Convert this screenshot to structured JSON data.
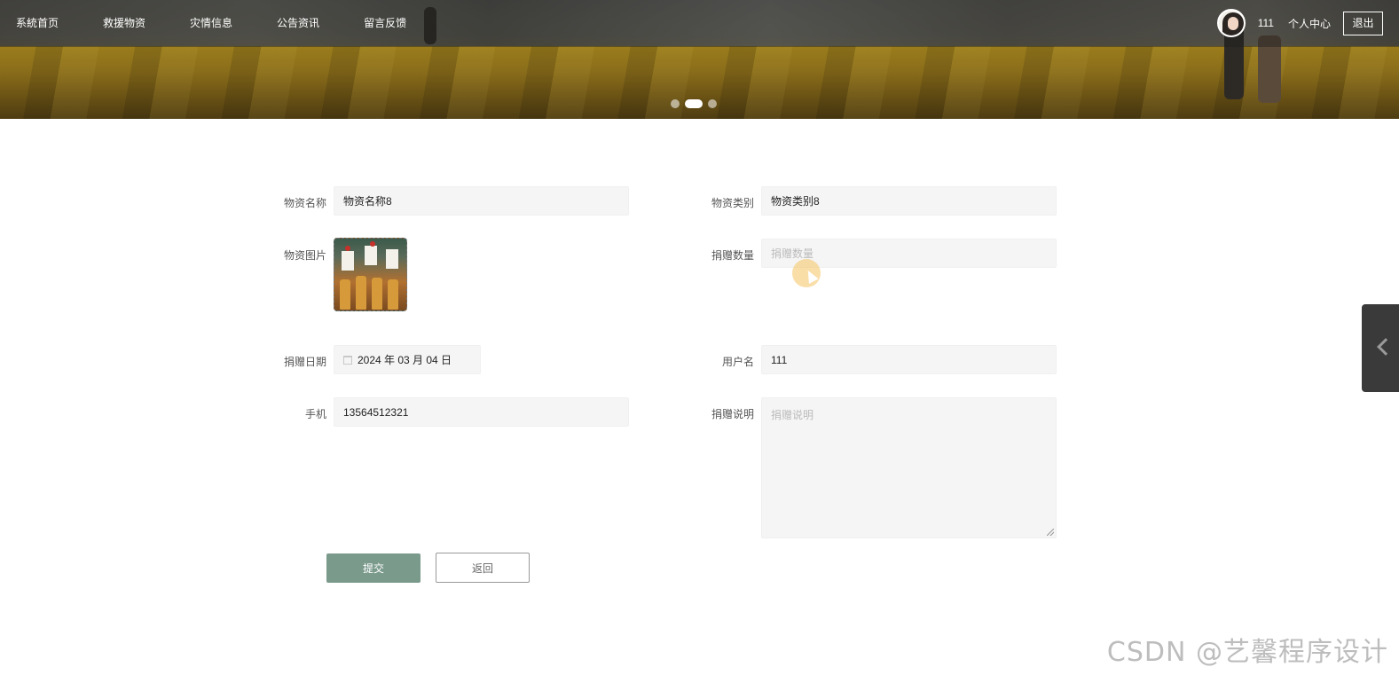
{
  "nav": {
    "items": [
      "系統首页",
      "救援物资",
      "灾情信息",
      "公告资讯",
      "留言反馈"
    ]
  },
  "user": {
    "name": "111",
    "center_label": "个人中心",
    "logout_label": "退出"
  },
  "carousel": {
    "active_index": 1,
    "count": 3
  },
  "form": {
    "material_name": {
      "label": "物资名称",
      "value": "物资名称8"
    },
    "material_category": {
      "label": "物资类别",
      "value": "物资类别8"
    },
    "material_image": {
      "label": "物资图片"
    },
    "donation_quantity": {
      "label": "捐赠数量",
      "placeholder": "捐赠数量"
    },
    "donation_date": {
      "label": "捐赠日期",
      "value": "2024 年 03 月 04 日"
    },
    "username": {
      "label": "用户名",
      "value": "111"
    },
    "phone": {
      "label": "手机",
      "value": "13564512321"
    },
    "donation_note": {
      "label": "捐赠说明",
      "placeholder": "捐赠说明"
    },
    "submit_label": "提交",
    "back_label": "返回"
  },
  "watermark": "CSDN @艺馨程序设计",
  "colors": {
    "submit": "#7a9a8c",
    "field_bg": "#f5f5f5",
    "side_tab": "#3a3a3a"
  },
  "icons": {
    "calendar": "calendar-icon",
    "side_toggle": "chevron-left-icon"
  }
}
